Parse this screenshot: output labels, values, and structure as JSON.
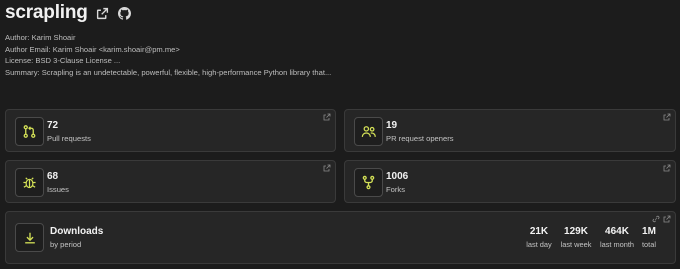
{
  "header": {
    "title": "scrapling",
    "icons": [
      "external-link-icon",
      "github-icon"
    ]
  },
  "meta": {
    "author": "Author: Karim Shoair",
    "author_email": "Author Email: Karim Shoair <karim.shoair@pm.me>",
    "license": "License: BSD 3-Clause License ...",
    "summary": "Summary: Scrapling is an undetectable, powerful, flexible, high-performance Python library that..."
  },
  "cards": {
    "pull_requests": {
      "value": "72",
      "label": "Pull requests",
      "icon": "git-pull-request-icon"
    },
    "pr_openers": {
      "value": "19",
      "label": "PR request openers",
      "icon": "users-icon"
    },
    "issues": {
      "value": "68",
      "label": "Issues",
      "icon": "bug-icon"
    },
    "forks": {
      "value": "1006",
      "label": "Forks",
      "icon": "git-fork-icon"
    }
  },
  "downloads": {
    "title": "Downloads",
    "subtitle": "by period",
    "icon": "download-icon",
    "stats": [
      {
        "value": "21K",
        "period": "last day"
      },
      {
        "value": "129K",
        "period": "last week"
      },
      {
        "value": "464K",
        "period": "last month"
      },
      {
        "value": "1M",
        "period": "total"
      }
    ]
  },
  "colors": {
    "background": "#1c1c1c",
    "card": "#262626",
    "accent_icon": "#d4e157"
  }
}
